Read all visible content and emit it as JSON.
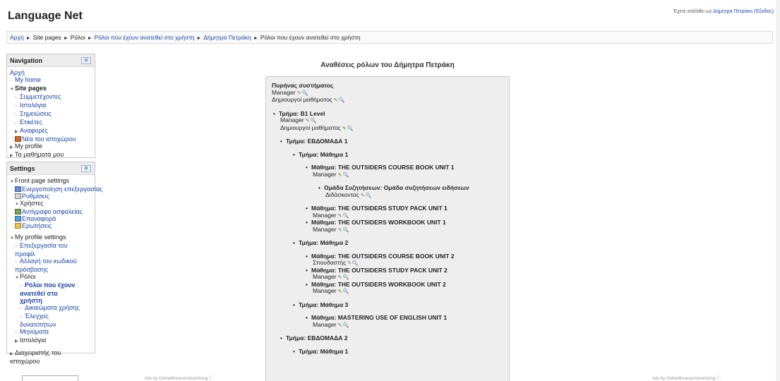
{
  "site": {
    "title": "Language Net",
    "login_prefix": "Έχετε εισέλθει ως",
    "login_user": "Δήμητρα Πετράκη",
    "logout": "(Έξοδος)"
  },
  "breadcrumb": {
    "items": [
      "Αρχή",
      "Site pages",
      "Ρόλοι",
      "Ρόλοι που έχουν ανατεθεί στο χρήστη",
      "Δήμητρα Πετράκη",
      "Ρόλοι που έχουν ανατεθεί στο χρήστη"
    ],
    "separator": "►"
  },
  "navigation": {
    "title": "Navigation",
    "dock": "⊟",
    "home": "Αρχή",
    "my_home": "My home",
    "site_pages": "Site pages",
    "site_items": [
      "Συμμετέχοντες",
      "Ιστολόγια",
      "Σημειώσεις",
      "Ετικέτες"
    ],
    "reports": "Αναφορές",
    "news": "Νέα του ιστοχώρου",
    "my_profile": "My profile",
    "my_courses": "Τα μαθήματά μου"
  },
  "settings": {
    "title": "Settings",
    "dock": "⊟",
    "front_page": "Front page settings",
    "fp_items": [
      "Ενεργοποίηση επεξεργασίας",
      "Ρυθμίσεις",
      "Χρήστες",
      "Αντίγραφο ασφαλείας",
      "Επαναφορά",
      "Ερωτήσεις"
    ],
    "my_profile_settings": "My profile settings",
    "edit_profile": "Επεξεργασία του προφίλ",
    "change_password": "Αλλαγή του κωδικού πρόσβασης",
    "roles": "Ρόλοι",
    "roles_current": "Ρόλοι που έχουν ανατεθεί στο χρήστη",
    "permissions": "Δικαιώματα χρήσης",
    "capabilities": "Έλεγχος δυνατοτήτων",
    "messages": "Μηνύματα",
    "blogs": "Ιστολόγια",
    "site_admin": "Διαχειριστής του ιστοχώρου"
  },
  "main": {
    "heading": "Αναθέσεις ρόλων του Δήμητρα Πετράκη",
    "system_context": "Πυρήνας συστήματος",
    "roles_system": [
      "Manager",
      "Δημιουργοί μαθήματος"
    ],
    "category_b1": "Τμήμα: B1 Level",
    "roles_b1": [
      "Manager",
      "Δημιουργοί μαθήματος"
    ],
    "week1": "Τμήμα: ΕΒΔΟΜΑΔΑ 1",
    "lesson1": "Τμήμα: Μάθημα 1",
    "course1": "Μάθημα: THE OUTSIDERS COURSE BOOK UNIT 1",
    "course1_role": "Manager",
    "forum": "Ομάδα Συζητήσεων: Ομάδα συζητήσεων ειδήσεων",
    "forum_role": "Διδάσκοντας",
    "course2": "Μάθημα: THE OUTSIDERS STUDY PACK UNIT 1",
    "course2_role": "Manager",
    "course3": "Μάθημα: THE OUTSIDERS WORKBOOK UNIT 1",
    "course3_role": "Manager",
    "lesson2": "Τμήμα: Μάθημα 2",
    "course4": "Μάθημα: THE OUTSIDERS COURSE BOOK UNIT 2",
    "course4_role": "Σπουδαστής",
    "course5": "Μάθημα: THE OUTSIDERS STUDY PACK UNIT 2",
    "course5_role": "Manager",
    "course6": "Μάθημα: THE OUTSIDERS WORKBOOK UNIT 2",
    "course6_role": "Manager",
    "lesson3": "Τμήμα: Μάθημα 3",
    "course7": "Μάθημα: MASTERING USE OF ENGLISH UNIT 1",
    "course7_role": "Manager",
    "week2": "Τμήμα: ΕΒΔΟΜΑΔΑ 2",
    "lesson1b": "Τμήμα: Μάθημα 1",
    "action_edit": "✎",
    "action_view": "🔍"
  },
  "ads": {
    "left": "Ads by OnlineBrowserAdvertising",
    "right": "Ads by OnlineBrowserAdvertising",
    "info": "ⓘ"
  }
}
